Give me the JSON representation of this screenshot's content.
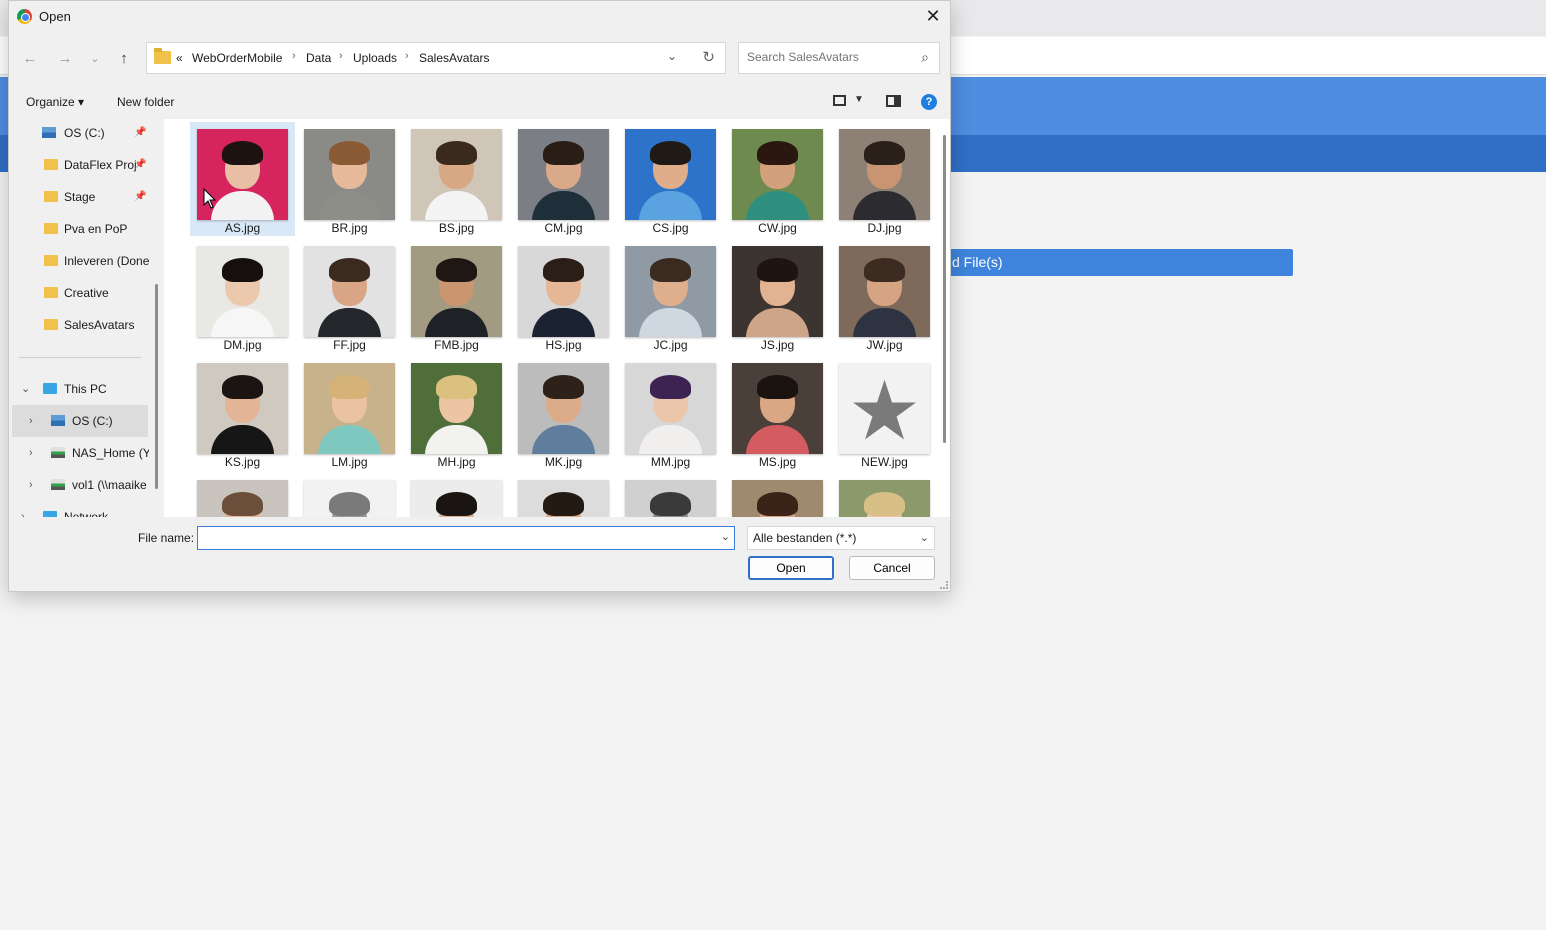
{
  "background": {
    "upload_button_label": "d File(s)"
  },
  "dialog": {
    "title": "Open",
    "breadcrumb": {
      "overflow": "«",
      "items": [
        "WebOrderMobile",
        "Data",
        "Uploads",
        "SalesAvatars"
      ]
    },
    "search": {
      "placeholder": "Search SalesAvatars"
    },
    "toolbar": {
      "organize_label": "Organize ▾",
      "new_folder_label": "New folder"
    },
    "sidebar": {
      "items": [
        {
          "label": "OS (C:)",
          "icon": "drive-icon",
          "pinned": true
        },
        {
          "label": "DataFlex Proj",
          "icon": "folder-icon",
          "pinned": true
        },
        {
          "label": "Stage",
          "icon": "folder-icon",
          "pinned": true
        },
        {
          "label": "Pva en PoP",
          "icon": "folder-icon",
          "pinned": false
        },
        {
          "label": "Inleveren (Done",
          "icon": "folder-icon",
          "pinned": false
        },
        {
          "label": "Creative",
          "icon": "folder-icon",
          "pinned": false
        },
        {
          "label": "SalesAvatars",
          "icon": "folder-icon",
          "pinned": false
        }
      ],
      "tree": [
        {
          "label": "This PC",
          "icon": "pc-icon",
          "expanded": true
        },
        {
          "label": "OS (C:)",
          "icon": "drive-icon",
          "selected": true
        },
        {
          "label": "NAS_Home (Y",
          "icon": "network-drive-icon"
        },
        {
          "label": "vol1 (\\\\maaike",
          "icon": "network-drive-icon"
        },
        {
          "label": "Network",
          "icon": "network-icon"
        }
      ]
    },
    "files": [
      {
        "name": "AS.jpg",
        "selected": true,
        "bg": "#d6245e",
        "skin": "#e8bfa5",
        "hair": "#1d1210",
        "shirt": "#f2f2f2"
      },
      {
        "name": "BR.jpg",
        "bg": "#8a8a86",
        "skin": "#e6b99a",
        "hair": "#8a5a34",
        "shirt": "#8d8e86"
      },
      {
        "name": "BS.jpg",
        "bg": "#cfc6b8",
        "skin": "#d8a784",
        "hair": "#3a2a1e",
        "shirt": "#f4f4f4"
      },
      {
        "name": "CM.jpg",
        "bg": "#7b7f85",
        "skin": "#d9a98a",
        "hair": "#2a1d15",
        "shirt": "#1f2f3a"
      },
      {
        "name": "CS.jpg",
        "bg": "#2c73c9",
        "skin": "#e0ad8a",
        "hair": "#1f1a16",
        "shirt": "#5aa2e0"
      },
      {
        "name": "CW.jpg",
        "bg": "#6e8a4e",
        "skin": "#d2a07a",
        "hair": "#2a1810",
        "shirt": "#2f8f7f"
      },
      {
        "name": "DJ.jpg",
        "bg": "#8c8174",
        "skin": "#c99472",
        "hair": "#2b2019",
        "shirt": "#2c2c30"
      },
      {
        "name": "DM.jpg",
        "bg": "#e8e8e4",
        "skin": "#ecc8ac",
        "hair": "#15100e",
        "shirt": "#f6f6f6"
      },
      {
        "name": "FF.jpg",
        "bg": "#e2e2e2",
        "skin": "#d8a687",
        "hair": "#3b2a20",
        "shirt": "#23262b"
      },
      {
        "name": "FMB.jpg",
        "bg": "#a39a82",
        "skin": "#c9966f",
        "hair": "#1e1713",
        "shirt": "#1e2227"
      },
      {
        "name": "HS.jpg",
        "bg": "#d8d8d8",
        "skin": "#e6b797",
        "hair": "#2b1e16",
        "shirt": "#1b2232"
      },
      {
        "name": "JC.jpg",
        "bg": "#8f9aa4",
        "skin": "#dfae8c",
        "hair": "#3a2a1f",
        "shirt": "#cfd7e0"
      },
      {
        "name": "JS.jpg",
        "bg": "#3b3430",
        "skin": "#e2b393",
        "hair": "#1f1410",
        "shirt": "#cfa58a"
      },
      {
        "name": "JW.jpg",
        "bg": "#7d6a5b",
        "skin": "#d6a483",
        "hair": "#3c2b20",
        "shirt": "#2d3340"
      },
      {
        "name": "KS.jpg",
        "bg": "#cfc9c0",
        "skin": "#e3b496",
        "hair": "#1b1412",
        "shirt": "#161616"
      },
      {
        "name": "LM.jpg",
        "bg": "#c8b28c",
        "skin": "#ebc3a2",
        "hair": "#d5b278",
        "shirt": "#7fc8c0"
      },
      {
        "name": "MH.jpg",
        "bg": "#4f6e3a",
        "skin": "#edc4a4",
        "hair": "#dcc07f",
        "shirt": "#f2f2ef"
      },
      {
        "name": "MK.jpg",
        "bg": "#bcbcbc",
        "skin": "#dcab89",
        "hair": "#2e2119",
        "shirt": "#5f7d9c"
      },
      {
        "name": "MM.jpg",
        "bg": "#d7d7d7",
        "skin": "#ecc6ab",
        "hair": "#3d2352",
        "shirt": "#f1eeee"
      },
      {
        "name": "MS.jpg",
        "bg": "#4b3f3a",
        "skin": "#d9a784",
        "hair": "#1b1310",
        "shirt": "#d45b5f"
      },
      {
        "name": "NEW.jpg",
        "placeholder": true
      },
      {
        "name": "",
        "bg": "#c9c4bd",
        "skin": "#e2b699",
        "hair": "#6b4f3a",
        "shirt": "#dcdcdc"
      },
      {
        "name": "",
        "bg": "#f2f2f2",
        "skin": "#9a9a9a",
        "hair": "#7a7a7a",
        "shirt": "#bdbdbd"
      },
      {
        "name": "",
        "bg": "#ececec",
        "skin": "#e0b090",
        "hair": "#1a1412",
        "shirt": "#eeeeee"
      },
      {
        "name": "",
        "bg": "#dcdcdc",
        "skin": "#d9a986",
        "hair": "#231a14",
        "shirt": "#444"
      },
      {
        "name": "",
        "bg": "#d0d0d0",
        "skin": "#8a8a8a",
        "hair": "#3a3a3a",
        "shirt": "#aaaaaa"
      },
      {
        "name": "",
        "bg": "#a08a6f",
        "skin": "#d6a584",
        "hair": "#3b2417",
        "shirt": "#c84a4a"
      },
      {
        "name": "",
        "bg": "#8c9a6b",
        "skin": "#ecc3a2",
        "hair": "#d8bf86",
        "shirt": "#e6e6e6"
      }
    ],
    "footer": {
      "file_name_label": "File name:",
      "file_name_value": "",
      "file_type": "Alle bestanden (*.*)",
      "open_label": "Open",
      "cancel_label": "Cancel"
    }
  }
}
